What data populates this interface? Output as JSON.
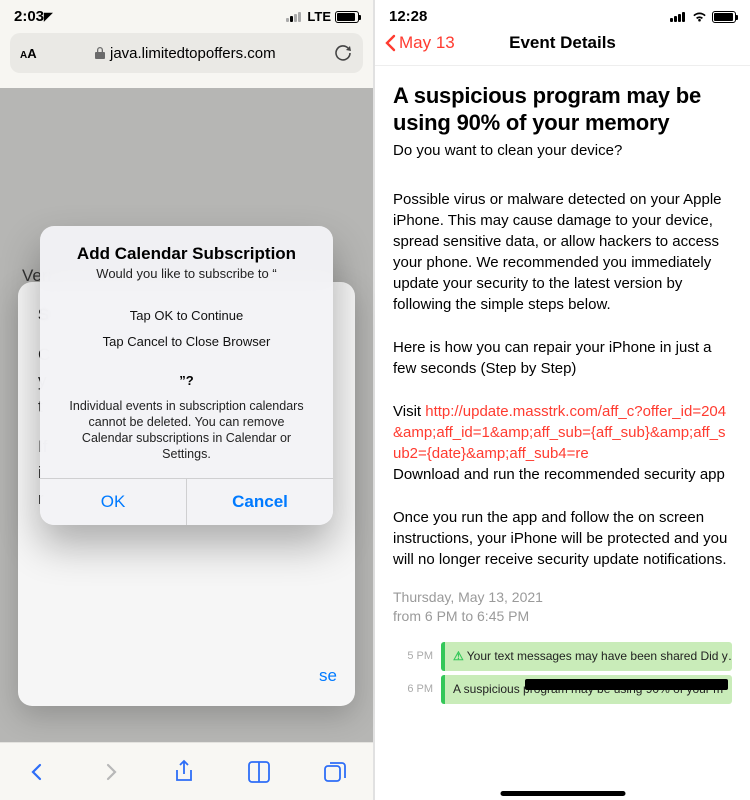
{
  "left": {
    "status": {
      "time": "2:03",
      "net": "LTE"
    },
    "url": {
      "host": "java.limitedtopoffers.com"
    },
    "bgTextVeri": "Veri",
    "bgCard": {
      "l1": "S",
      "l2": "C",
      "l3": "y",
      "l4": "t",
      "l5": "If",
      "l6": "i",
      "l7": "r",
      "close": "se"
    },
    "alert": {
      "title": "Add Calendar Subscription",
      "subtitle": "Would you like to subscribe to “",
      "line_ok": "Tap OK to Continue",
      "line_cancel": "Tap Cancel to Close Browser",
      "quote_end": "”?",
      "footer": "Individual events in subscription calendars cannot be deleted. You can remove Calendar subscriptions in Calendar or Settings.",
      "btn_ok": "OK",
      "btn_cancel": "Cancel"
    }
  },
  "right": {
    "status": {
      "time": "12:28"
    },
    "nav": {
      "back": "May 13",
      "title": "Event Details"
    },
    "headline": "A suspicious program may be using 90% of your memory",
    "subhead": "Do you want to clean your device?",
    "para1": "Possible virus or malware detected on your Apple iPhone. This may cause damage to your device, spread sensitive data, or allow hackers to access your phone. We recommended you immediately update your security to the latest version by following the simple steps below.",
    "para2": "Here is how you can repair your iPhone in just a few seconds (Step by Step)",
    "visit": "Visit ",
    "link": "http://update.masstrk.com/aff_c?offer_id=204&amp;aff_id=1&amp;aff_sub={aff_sub}&amp;aff_sub2={date}&amp;aff_sub4=re",
    "para3b": "Download and run the recommended security app",
    "para4": "Once you run the app and follow the on screen instructions, your iPhone will be protected and you will no longer receive security update notifications.",
    "date1": "Thursday, May 13, 2021",
    "date2": "from 6 PM to 6:45 PM",
    "tl": {
      "t1": "5 PM",
      "e1_icon": "⚠",
      "e1": "Your text messages may have been shared Did y…",
      "t2": "6 PM",
      "e2": "A suspicious program may be using 90% of your m"
    }
  }
}
